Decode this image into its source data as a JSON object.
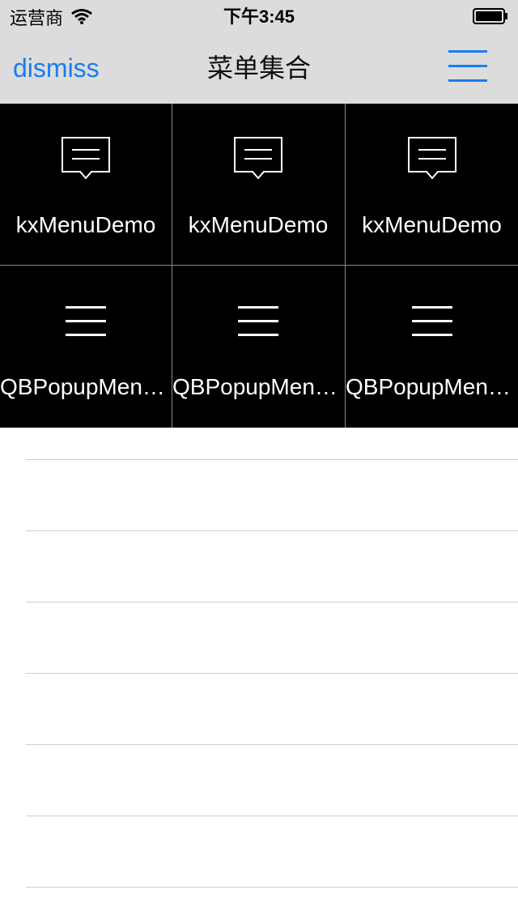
{
  "status_bar": {
    "carrier": "运营商",
    "time": "下午3:45"
  },
  "nav": {
    "dismiss_label": "dismiss",
    "title": "菜单集合",
    "menu_icon": "hamburger-icon"
  },
  "grid": {
    "items": [
      {
        "label": "kxMenuDemo",
        "icon": "message-icon"
      },
      {
        "label": "kxMenuDemo",
        "icon": "message-icon"
      },
      {
        "label": "kxMenuDemo",
        "icon": "message-icon"
      },
      {
        "label": "QBPopupMenu…",
        "icon": "list-icon"
      },
      {
        "label": "QBPopupMenu…",
        "icon": "list-icon"
      },
      {
        "label": "QBPopupMenu…",
        "icon": "list-icon"
      }
    ]
  },
  "colors": {
    "accent": "#1a7cf0",
    "nav_background": "#dcdcdc",
    "grid_background": "#000000"
  }
}
